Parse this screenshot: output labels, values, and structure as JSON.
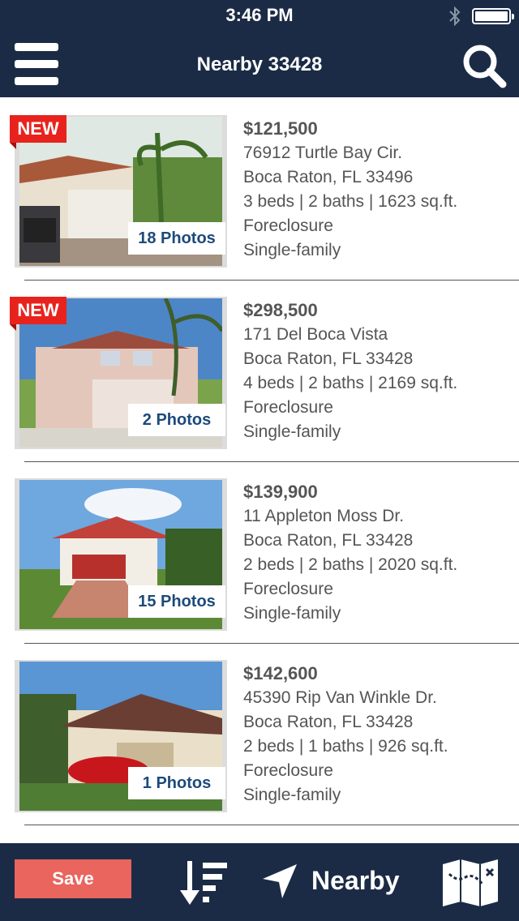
{
  "status_bar": {
    "time": "3:46 PM"
  },
  "nav": {
    "title": "Nearby 33428"
  },
  "listings": [
    {
      "new_badge": "NEW",
      "photos": "18 Photos",
      "price": "$121,500",
      "street": "76912 Turtle Bay Cir.",
      "city": "Boca Raton, FL 33496",
      "specs": "3 beds | 2 baths | 1623 sq.ft.",
      "status": "Foreclosure",
      "type": "Single-family"
    },
    {
      "new_badge": "NEW",
      "photos": "2 Photos",
      "price": "$298,500",
      "street": "171 Del Boca Vista",
      "city": "Boca Raton, FL 33428",
      "specs": "4 beds | 2 baths | 2169 sq.ft.",
      "status": "Foreclosure",
      "type": "Single-family"
    },
    {
      "photos": "15 Photos",
      "price": "$139,900",
      "street": "11 Appleton Moss Dr.",
      "city": "Boca Raton, FL 33428",
      "specs": "2 beds | 2 baths | 2020 sq.ft.",
      "status": "Foreclosure",
      "type": "Single-family"
    },
    {
      "photos": "1 Photos",
      "price": "$142,600",
      "street": "45390 Rip Van Winkle Dr.",
      "city": "Boca Raton, FL 33428",
      "specs": "2 beds | 1 baths | 926 sq.ft.",
      "status": "Foreclosure",
      "type": "Single-family"
    }
  ],
  "toolbar": {
    "save_label": "Save",
    "nearby_label": "Nearby"
  },
  "icons": {
    "menu": "menu-icon",
    "search": "search-icon",
    "bluetooth": "bluetooth-icon",
    "battery": "battery-icon",
    "sort": "sort-icon",
    "nearby": "location-arrow-icon",
    "map": "map-icon"
  },
  "colors": {
    "header_bg": "#1b2b45",
    "new_badge": "#e8231d",
    "save_button": "#e9655e",
    "photos_text": "#1d4a7a"
  }
}
